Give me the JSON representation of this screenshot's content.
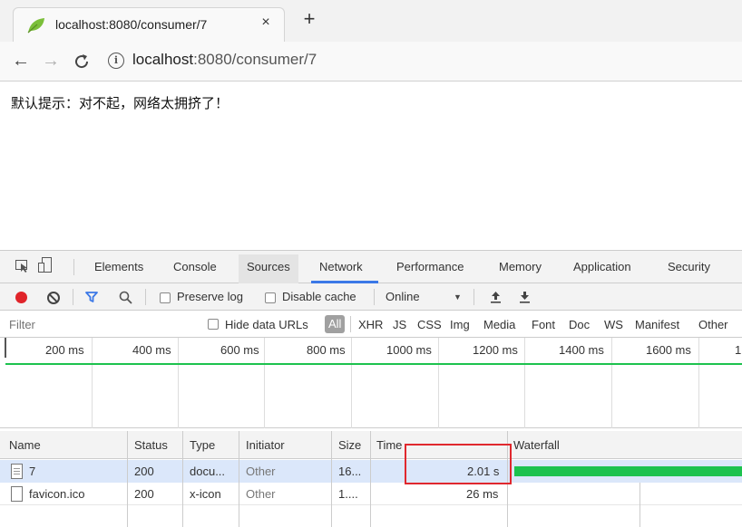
{
  "browser": {
    "tab_title": "localhost:8080/consumer/7",
    "close_glyph": "×",
    "new_tab_glyph": "+",
    "address_host": "localhost",
    "address_rest": ":8080/consumer/7",
    "icons": [
      "leaf-icon",
      "back-icon",
      "forward-icon",
      "reload-icon",
      "info-icon"
    ]
  },
  "page": {
    "message": "默认提示：对不起，网络太拥挤了！"
  },
  "devtools": {
    "tabs": [
      "Elements",
      "Console",
      "Sources",
      "Network",
      "Performance",
      "Memory",
      "Application",
      "Security"
    ],
    "active_tab": "Network",
    "accent_color": "#3b78e7",
    "toolbar": {
      "preserve_log": "Preserve log",
      "disable_cache": "Disable cache",
      "throttle": "Online"
    },
    "filter": {
      "placeholder": "Filter",
      "hide_data_urls": "Hide data URLs",
      "all": "All",
      "types": [
        "XHR",
        "JS",
        "CSS",
        "Img",
        "Media",
        "Font",
        "Doc",
        "WS",
        "Manifest",
        "Other"
      ]
    },
    "overview": {
      "labels": [
        "200 ms",
        "400 ms",
        "600 ms",
        "800 ms",
        "1000 ms",
        "1200 ms",
        "1400 ms",
        "1600 ms",
        "1"
      ],
      "line_color": "#1dc24e"
    },
    "grid": {
      "columns": [
        "Name",
        "Status",
        "Type",
        "Initiator",
        "Size",
        "Time",
        "Waterfall"
      ],
      "rows": [
        {
          "name": "7",
          "status": "200",
          "type": "docu...",
          "initiator": "Other",
          "size": "16...",
          "time": "2.01 s",
          "waterfall_fraction": 1.0
        },
        {
          "name": "favicon.ico",
          "status": "200",
          "type": "x-icon",
          "initiator": "Other",
          "size": "1....",
          "time": "26 ms"
        }
      ],
      "selected_row_color": "#dbe7fa",
      "waterfall_color": "#1dc24e",
      "highlight_color": "#e0282e"
    }
  }
}
